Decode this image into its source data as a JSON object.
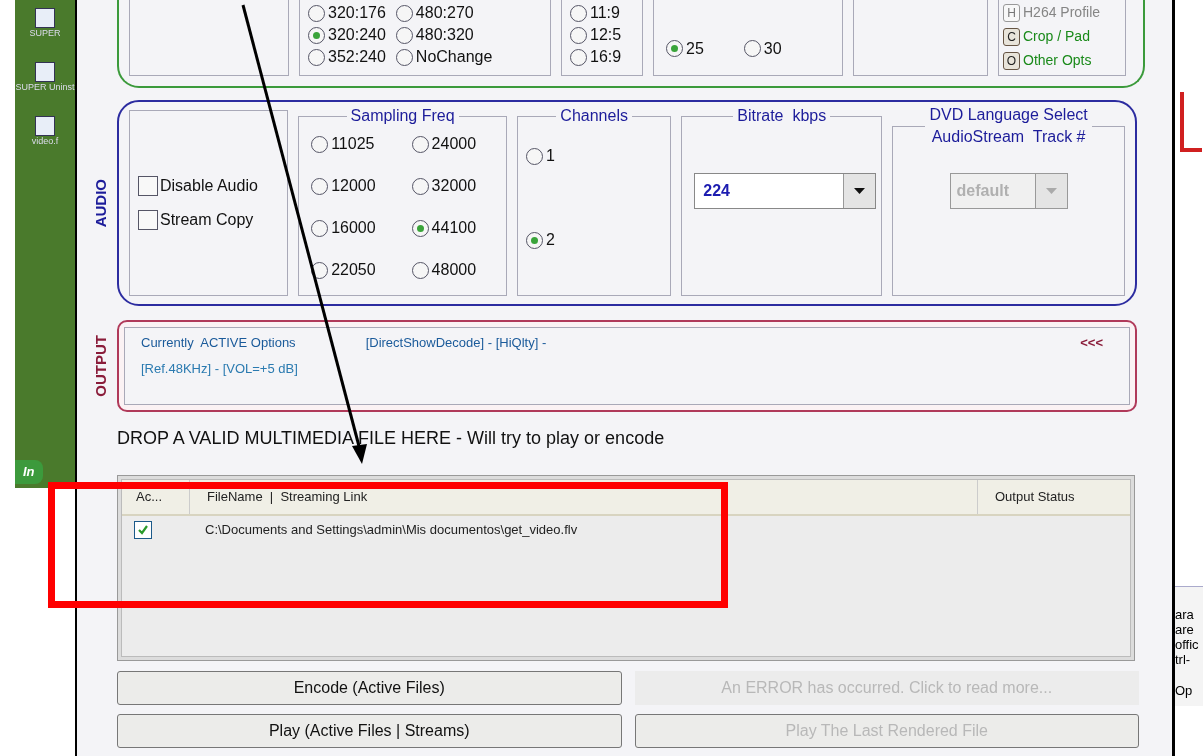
{
  "desktop": {
    "icons": [
      {
        "label": "SUPER"
      },
      {
        "label": "SUPER Uninst"
      },
      {
        "label": "video.f"
      }
    ],
    "start_button": "In"
  },
  "video": {
    "resolution_options": [
      {
        "label": "320:176",
        "selected": false
      },
      {
        "label": "320:240",
        "selected": true
      },
      {
        "label": "352:240",
        "selected": false
      },
      {
        "label": "480:270",
        "selected": false
      },
      {
        "label": "480:320",
        "selected": false
      },
      {
        "label": "NoChange",
        "selected": false
      }
    ],
    "aspect_options": [
      {
        "label": "11:9",
        "selected": false
      },
      {
        "label": "12:5",
        "selected": false
      },
      {
        "label": "16:9",
        "selected": false
      }
    ],
    "fps_options": [
      {
        "label": "25",
        "selected": true
      },
      {
        "label": "30",
        "selected": false
      }
    ],
    "option_buttons": [
      {
        "key": "H",
        "label": "H264 Profile",
        "disabled": true
      },
      {
        "key": "C",
        "label": "Crop / Pad",
        "disabled": false
      },
      {
        "key": "O",
        "label": "Other Opts",
        "disabled": false
      }
    ]
  },
  "audio": {
    "label": "AUDIO",
    "checkboxes": [
      {
        "label": "Disable Audio",
        "checked": false
      },
      {
        "label": "Stream Copy",
        "checked": false
      }
    ],
    "sampling_freq": {
      "title": "Sampling Freq",
      "options": [
        {
          "label": "11025",
          "selected": false
        },
        {
          "label": "12000",
          "selected": false
        },
        {
          "label": "16000",
          "selected": false
        },
        {
          "label": "22050",
          "selected": false
        },
        {
          "label": "24000",
          "selected": false
        },
        {
          "label": "32000",
          "selected": false
        },
        {
          "label": "44100",
          "selected": true
        },
        {
          "label": "48000",
          "selected": false
        }
      ]
    },
    "channels": {
      "title": "Channels",
      "options": [
        {
          "label": "1",
          "selected": false
        },
        {
          "label": "2",
          "selected": true
        }
      ]
    },
    "bitrate": {
      "title": "Bitrate  kbps",
      "value": "224",
      "disabled": false
    },
    "dvd_language": {
      "title_lines": [
        "DVD Language Select",
        "AudioStream  Track #"
      ],
      "value": "default",
      "disabled": true
    }
  },
  "output": {
    "label": "OUTPUT",
    "options_title": "Currently  ACTIVE Options",
    "options_lines": [
      "[DirectShowDecode] - [HiQlty] -",
      "[Ref.48KHz] - [VOL=+5 dB]"
    ],
    "collapse": "<<<"
  },
  "drop_hint": "DROP A VALID MULTIMEDIA FILE HERE - Will try to play or encode",
  "file_table": {
    "columns": [
      "Ac...",
      "FileName  |  Streaming Link",
      "Output Status"
    ],
    "rows": [
      {
        "active": true,
        "file": "C:\\Documents and Settings\\admin\\Mis documentos\\get_video.flv"
      }
    ]
  },
  "buttons": [
    {
      "label": "Encode (Active Files)",
      "disabled": false
    },
    {
      "label": "An ERROR has occurred. Click to read more...",
      "disabled": true
    },
    {
      "label": "Play (Active Files | Streams)",
      "disabled": false
    },
    {
      "label": "Play The Last Rendered File",
      "disabled": true
    }
  ],
  "side_window": {
    "lines": [
      "ara",
      "are",
      "offic",
      "trl-"
    ],
    "tab": "Op"
  }
}
